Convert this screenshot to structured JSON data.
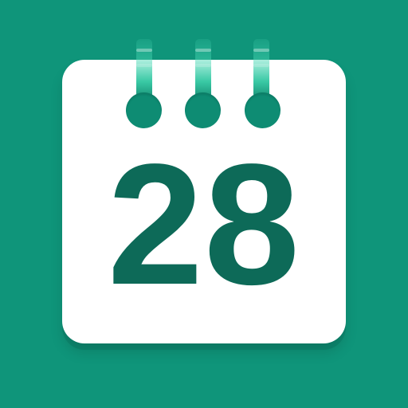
{
  "app": {
    "icon_name": "calendar-icon",
    "day": "28"
  },
  "colors": {
    "background": "#0f957a",
    "sheet": "#ffffff",
    "text": "#0d6a58",
    "ring_holes": "#0e8c73",
    "ring_stem_accent": "#2fc6a0"
  }
}
